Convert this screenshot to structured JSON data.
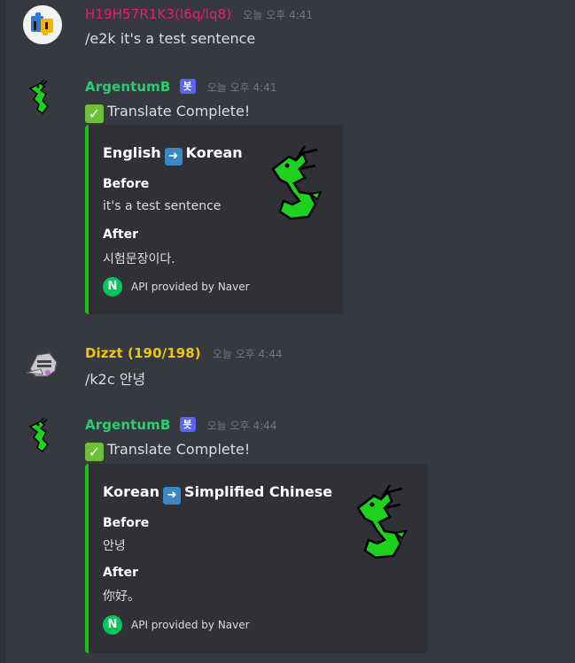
{
  "colors": {
    "background": "#36393f",
    "embed_background": "#2f3136",
    "embed_border": "#16c60c",
    "user1_name": "#e91e63",
    "bot_name": "#2ecc71",
    "user2_name": "#f1c40f",
    "bot_tag": "#5865f2",
    "timestamp": "#72767d",
    "naver_green": "#03c75a"
  },
  "messages": [
    {
      "username": "H19H57R1K3(l6q/lq8)",
      "timestamp": "오늘 오후 4:41",
      "avatar_icon": "puzzle-piece-icon",
      "content": "/e2k it's a test sentence"
    },
    {
      "username": "ArgentumB",
      "bot_tag": "봇",
      "timestamp": "오늘 오후 4:41",
      "avatar_icon": "green-dragon-icon",
      "content": "Translate Complete!",
      "embed": {
        "title_from": "English",
        "title_to": "Korean",
        "arrow_icon": "right-arrow-icon",
        "before_label": "Before",
        "before_value": "it's a test sentence",
        "after_label": "After",
        "after_value": "시험문장이다.",
        "footer_icon": "naver-icon",
        "footer_icon_letter": "N",
        "footer_text": "API provided by Naver",
        "thumbnail": "green-dragon-icon"
      }
    },
    {
      "username": "Dizzt (190/198)",
      "timestamp": "오늘 오후 4:44",
      "avatar_icon": "knight-helmet-icon",
      "content": "/k2c 안녕"
    },
    {
      "username": "ArgentumB",
      "bot_tag": "봇",
      "timestamp": "오늘 오후 4:44",
      "avatar_icon": "green-dragon-icon",
      "content": "Translate Complete!",
      "embed": {
        "title_from": "Korean",
        "title_to": "Simplified Chinese",
        "arrow_icon": "right-arrow-icon",
        "before_label": "Before",
        "before_value": "안녕",
        "after_label": "After",
        "after_value": "你好。",
        "footer_icon": "naver-icon",
        "footer_icon_letter": "N",
        "footer_text": "API provided by Naver",
        "thumbnail": "green-dragon-icon"
      }
    }
  ]
}
